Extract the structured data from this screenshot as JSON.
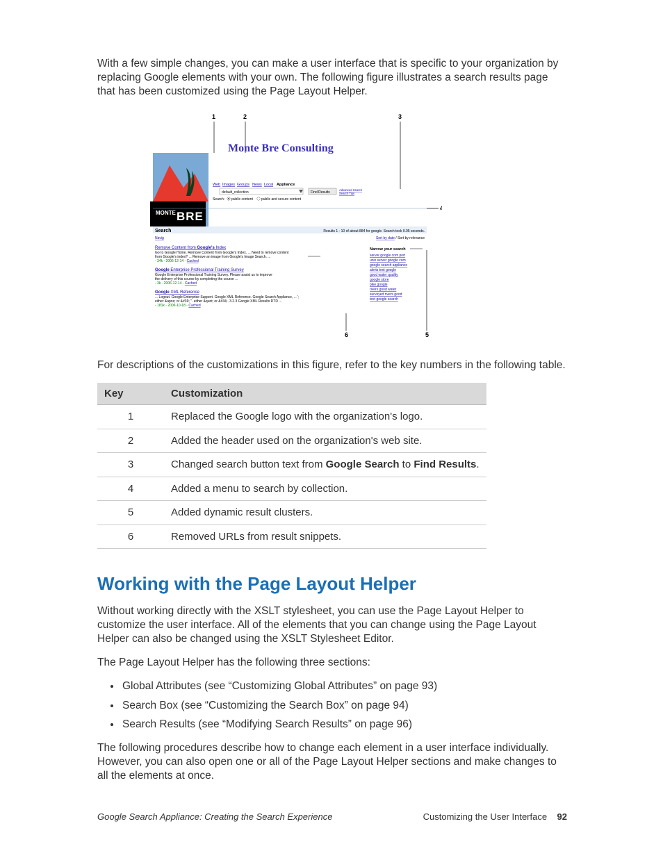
{
  "intro": "With a few simple changes, you can make a user interface that is specific to your organization by replacing Google elements with your own. The following figure illustrates a search results page that has been customized using the Page Layout Helper.",
  "figure": {
    "callouts": [
      "1",
      "2",
      "3",
      "4",
      "5",
      "6"
    ],
    "banner_title": "Monte Bre Consulting",
    "logo_line1": "MONTE",
    "logo_line2": "BRE",
    "tabs": {
      "web": "Web",
      "images": "Images",
      "groups": "Groups",
      "news": "News",
      "local": "Local",
      "appliance": "Appliance"
    },
    "searchbox_value": "default_collection",
    "search_button": "Find Results",
    "adv_search": "Advanced Search",
    "search_tips": "Search Tips",
    "search_label": "Search:",
    "pub_content": "public content",
    "pub_secure": "public and secure content",
    "search_heading": "Search",
    "results_info": "Results 1 - 10 of about 884 for google. Search took 0.05 seconds.",
    "navy": "Navig",
    "sort_date": "Sort by date",
    "sort_rel": "Sort by relevance",
    "r1": {
      "title_a": "Remove Content from ",
      "title_b": "Google's",
      "title_c": " Index",
      "l1": "Go to Google Home. Remove Content from Google's Index. ... Need to remove content",
      "l2": "from Google's index? ... Remove an image from Google's Image Search. ...",
      "meta": "- 34k - 2006-12-14 - ",
      "cached": "Cached"
    },
    "r2": {
      "title_a": "Google",
      "title_b": " Enterprise Professional Training Survey",
      "l1": "Google Enterprise Professional Training Survey. Please assist us to improve",
      "l2": "the delivery of this course by completing the course ...",
      "meta": "- 3k - 2006-12-14 - ",
      "cached": "Cached"
    },
    "r3": {
      "title_a": "Google",
      "title_b": " XML Reference",
      "l1": "... Logout. Google Enterprise Support. Google XML Reference. Google Search Appliance, ... ';",
      "l2": "either &apos; or &#39; \". either &quot; or &#34;. 3.2.3 Google XML Results DTD ...",
      "meta": "- 181k - 2006-10-18 - ",
      "cached": "Cached"
    },
    "narrow_heading": "Narrow your search",
    "narrow": [
      "server google com port",
      "unix server google com",
      "google search appliance",
      "alerts text google",
      "good water quality",
      "google store",
      "pike google",
      "rivers good water",
      "surveyed rivers good",
      "text google search"
    ]
  },
  "after_fig": "For descriptions of the customizations in this figure, refer to the key numbers in the following table.",
  "table": {
    "h_key": "Key",
    "h_cust": "Customization",
    "rows": [
      {
        "k": "1",
        "t": "Replaced the Google logo with the organization's logo."
      },
      {
        "k": "2",
        "t": "Added the header used on the organization's web site."
      },
      {
        "k": "3",
        "ta": "Changed search button text from ",
        "tb": "Google Search",
        "tc": " to ",
        "td": "Find Results",
        "te": "."
      },
      {
        "k": "4",
        "t": "Added a menu to search by collection."
      },
      {
        "k": "5",
        "t": " Added dynamic result clusters."
      },
      {
        "k": "6",
        "t": "Removed URLs from result snippets."
      }
    ]
  },
  "section_title": "Working with the Page Layout Helper",
  "sec_p1": "Without working directly with the XSLT stylesheet, you can use the Page Layout Helper to customize the user interface. All of the elements that you can change using the Page Layout Helper can also be changed using the XSLT Stylesheet Editor.",
  "sec_p2": "The Page Layout Helper has the following three sections:",
  "bullets": [
    "Global Attributes (see “Customizing Global Attributes” on page 93)",
    "Search Box (see “Customizing the Search Box” on page 94)",
    "Search Results (see “Modifying Search Results” on page 96)"
  ],
  "sec_p3": "The following procedures describe how to change each element in a user interface individually. However, you can also open one or all of the Page Layout Helper sections and make changes to all the elements at once.",
  "footer": {
    "left": "Google Search Appliance: Creating the Search Experience",
    "right_label": "Customizing the User Interface",
    "page": "92"
  }
}
